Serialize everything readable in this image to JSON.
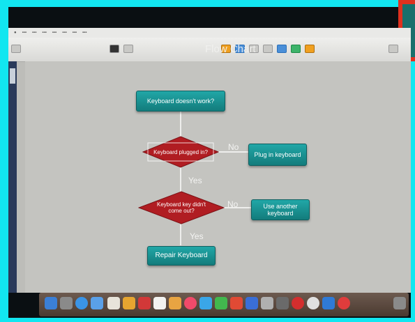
{
  "slide_title": "Flow Chart",
  "nodes": {
    "start": "Keyboard doesn't work?",
    "decision1": "Keyboard plugged in?",
    "action1": "Plug in keyboard",
    "decision2": "Keyboard key didn't come out?",
    "action2": "Use another keyboard",
    "end": "Repair Keyboard"
  },
  "edge_labels": {
    "d1_no": "No",
    "d1_yes": "Yes",
    "d2_no": "No",
    "d2_yes": "Yes"
  },
  "colors": {
    "process_box": "#1a9595",
    "decision": "#b01d22",
    "frame": "#12e6f0",
    "corner": "#e0301e"
  },
  "dock_icons": [
    "finder-icon",
    "launchpad-icon",
    "rocket-icon",
    "safari-icon",
    "mail-icon",
    "calendar-icon",
    "notes-icon",
    "photos-icon",
    "messages-icon",
    "itunes-icon",
    "appstore-icon",
    "preferences-icon",
    "chrome-icon"
  ]
}
